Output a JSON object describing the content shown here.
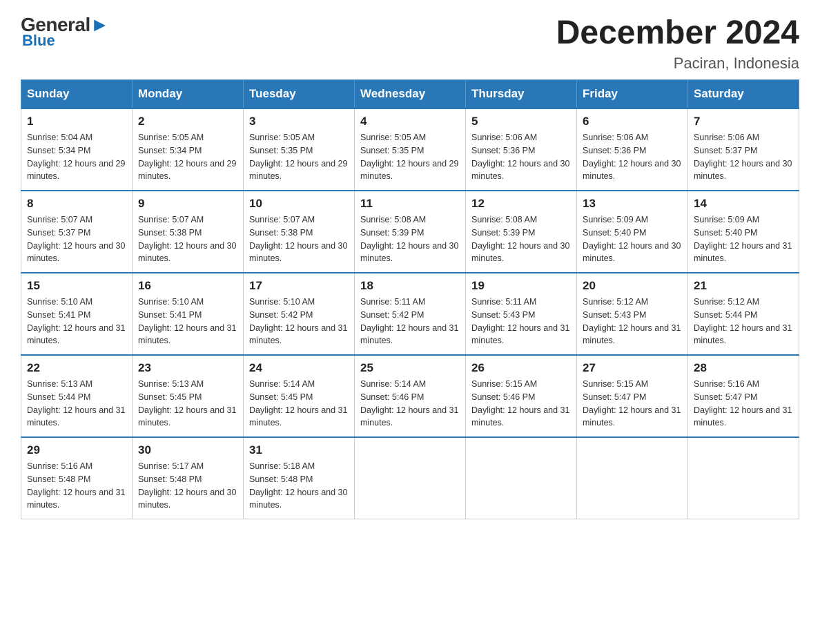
{
  "logo": {
    "general": "General",
    "blue": "Blue",
    "triangle": "▶"
  },
  "title": "December 2024",
  "subtitle": "Paciran, Indonesia",
  "days_of_week": [
    "Sunday",
    "Monday",
    "Tuesday",
    "Wednesday",
    "Thursday",
    "Friday",
    "Saturday"
  ],
  "weeks": [
    [
      {
        "day": "1",
        "sunrise": "5:04 AM",
        "sunset": "5:34 PM",
        "daylight": "12 hours and 29 minutes."
      },
      {
        "day": "2",
        "sunrise": "5:05 AM",
        "sunset": "5:34 PM",
        "daylight": "12 hours and 29 minutes."
      },
      {
        "day": "3",
        "sunrise": "5:05 AM",
        "sunset": "5:35 PM",
        "daylight": "12 hours and 29 minutes."
      },
      {
        "day": "4",
        "sunrise": "5:05 AM",
        "sunset": "5:35 PM",
        "daylight": "12 hours and 29 minutes."
      },
      {
        "day": "5",
        "sunrise": "5:06 AM",
        "sunset": "5:36 PM",
        "daylight": "12 hours and 30 minutes."
      },
      {
        "day": "6",
        "sunrise": "5:06 AM",
        "sunset": "5:36 PM",
        "daylight": "12 hours and 30 minutes."
      },
      {
        "day": "7",
        "sunrise": "5:06 AM",
        "sunset": "5:37 PM",
        "daylight": "12 hours and 30 minutes."
      }
    ],
    [
      {
        "day": "8",
        "sunrise": "5:07 AM",
        "sunset": "5:37 PM",
        "daylight": "12 hours and 30 minutes."
      },
      {
        "day": "9",
        "sunrise": "5:07 AM",
        "sunset": "5:38 PM",
        "daylight": "12 hours and 30 minutes."
      },
      {
        "day": "10",
        "sunrise": "5:07 AM",
        "sunset": "5:38 PM",
        "daylight": "12 hours and 30 minutes."
      },
      {
        "day": "11",
        "sunrise": "5:08 AM",
        "sunset": "5:39 PM",
        "daylight": "12 hours and 30 minutes."
      },
      {
        "day": "12",
        "sunrise": "5:08 AM",
        "sunset": "5:39 PM",
        "daylight": "12 hours and 30 minutes."
      },
      {
        "day": "13",
        "sunrise": "5:09 AM",
        "sunset": "5:40 PM",
        "daylight": "12 hours and 30 minutes."
      },
      {
        "day": "14",
        "sunrise": "5:09 AM",
        "sunset": "5:40 PM",
        "daylight": "12 hours and 31 minutes."
      }
    ],
    [
      {
        "day": "15",
        "sunrise": "5:10 AM",
        "sunset": "5:41 PM",
        "daylight": "12 hours and 31 minutes."
      },
      {
        "day": "16",
        "sunrise": "5:10 AM",
        "sunset": "5:41 PM",
        "daylight": "12 hours and 31 minutes."
      },
      {
        "day": "17",
        "sunrise": "5:10 AM",
        "sunset": "5:42 PM",
        "daylight": "12 hours and 31 minutes."
      },
      {
        "day": "18",
        "sunrise": "5:11 AM",
        "sunset": "5:42 PM",
        "daylight": "12 hours and 31 minutes."
      },
      {
        "day": "19",
        "sunrise": "5:11 AM",
        "sunset": "5:43 PM",
        "daylight": "12 hours and 31 minutes."
      },
      {
        "day": "20",
        "sunrise": "5:12 AM",
        "sunset": "5:43 PM",
        "daylight": "12 hours and 31 minutes."
      },
      {
        "day": "21",
        "sunrise": "5:12 AM",
        "sunset": "5:44 PM",
        "daylight": "12 hours and 31 minutes."
      }
    ],
    [
      {
        "day": "22",
        "sunrise": "5:13 AM",
        "sunset": "5:44 PM",
        "daylight": "12 hours and 31 minutes."
      },
      {
        "day": "23",
        "sunrise": "5:13 AM",
        "sunset": "5:45 PM",
        "daylight": "12 hours and 31 minutes."
      },
      {
        "day": "24",
        "sunrise": "5:14 AM",
        "sunset": "5:45 PM",
        "daylight": "12 hours and 31 minutes."
      },
      {
        "day": "25",
        "sunrise": "5:14 AM",
        "sunset": "5:46 PM",
        "daylight": "12 hours and 31 minutes."
      },
      {
        "day": "26",
        "sunrise": "5:15 AM",
        "sunset": "5:46 PM",
        "daylight": "12 hours and 31 minutes."
      },
      {
        "day": "27",
        "sunrise": "5:15 AM",
        "sunset": "5:47 PM",
        "daylight": "12 hours and 31 minutes."
      },
      {
        "day": "28",
        "sunrise": "5:16 AM",
        "sunset": "5:47 PM",
        "daylight": "12 hours and 31 minutes."
      }
    ],
    [
      {
        "day": "29",
        "sunrise": "5:16 AM",
        "sunset": "5:48 PM",
        "daylight": "12 hours and 31 minutes."
      },
      {
        "day": "30",
        "sunrise": "5:17 AM",
        "sunset": "5:48 PM",
        "daylight": "12 hours and 30 minutes."
      },
      {
        "day": "31",
        "sunrise": "5:18 AM",
        "sunset": "5:48 PM",
        "daylight": "12 hours and 30 minutes."
      },
      null,
      null,
      null,
      null
    ]
  ]
}
